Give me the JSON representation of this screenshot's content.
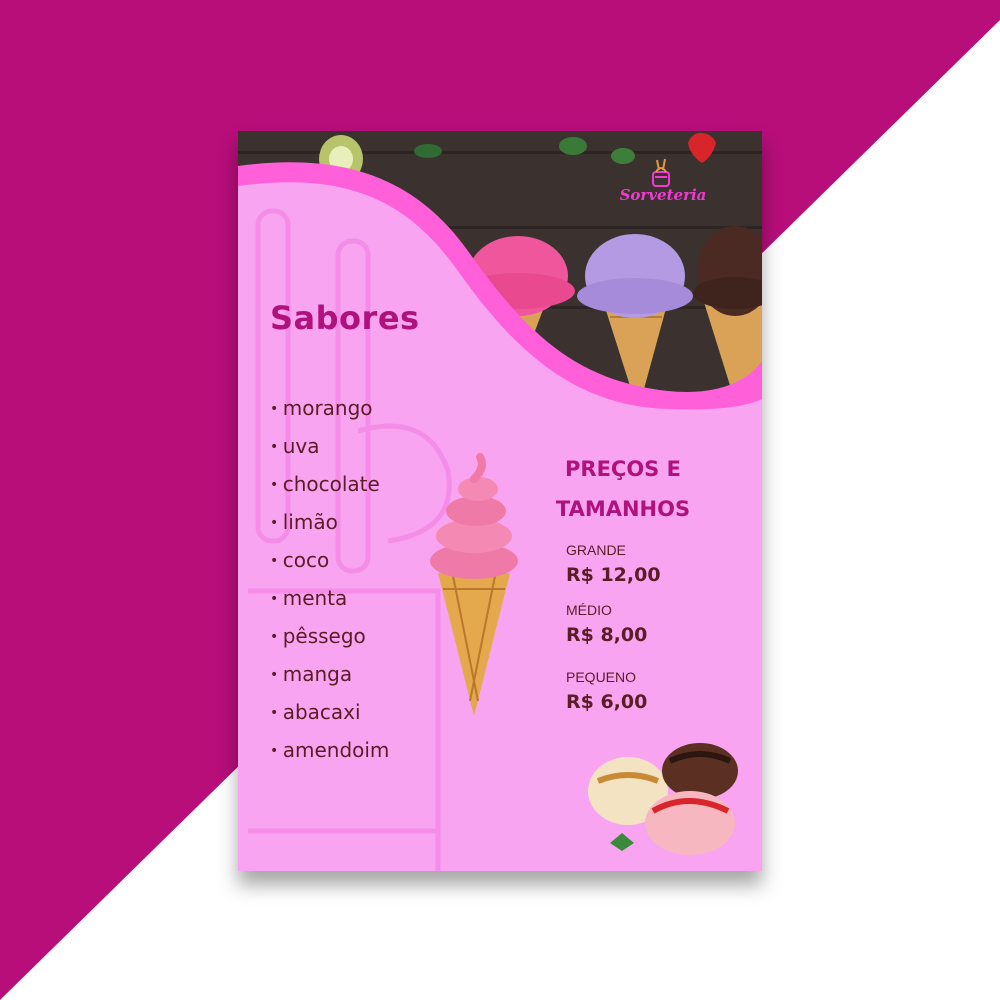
{
  "brand": {
    "name": "Sorveteria",
    "logo_icon": "ice-cream-cup-icon"
  },
  "flavors_section": {
    "title": "Sabores",
    "items": [
      "morango",
      "uva",
      "chocolate",
      "limão",
      "coco",
      "menta",
      "pêssego",
      "manga",
      "abacaxi",
      "amendoim"
    ]
  },
  "prices_section": {
    "title_line1": "PREÇOS E",
    "title_line2": "TAMANHOS",
    "sizes": [
      {
        "label": "GRANDE",
        "price": "R$ 12,00"
      },
      {
        "label": "MÉDIO",
        "price": "R$ 8,00"
      },
      {
        "label": "PEQUENO",
        "price": "R$ 6,00"
      }
    ]
  },
  "colors": {
    "background_magenta": "#b70e7a",
    "card_pink": "#f9a4f1",
    "wave_pink": "#ff5fd8",
    "accent_text": "#b0127d",
    "body_text": "#5a1c26"
  }
}
